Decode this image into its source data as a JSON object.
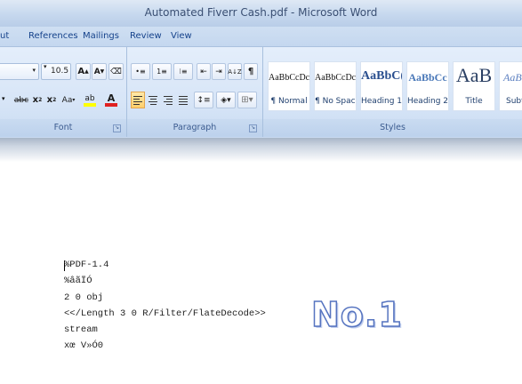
{
  "window": {
    "title": "Automated Fiverr Cash.pdf - Microsoft Word"
  },
  "tabs": [
    "ut",
    "References",
    "Mailings",
    "Review",
    "View"
  ],
  "font_group": {
    "label": "Font",
    "font_size": "10.5",
    "grow_glyph": "A",
    "shrink_glyph": "A",
    "clear_glyph": "⌫",
    "strike_glyph": "abc",
    "subscript_glyph": "x",
    "superscript_glyph": "x",
    "change_case_glyph": "Aa",
    "highlight_glyph": "ab",
    "font_color_glyph": "A",
    "highlight_color": "#ffff00",
    "font_color": "#e02020"
  },
  "paragraph_group": {
    "label": "Paragraph",
    "pilcrow": "¶",
    "sort_glyph": "A↓Z"
  },
  "styles_group": {
    "label": "Styles",
    "tiles": [
      {
        "sample": "AaBbCcDc",
        "name": "¶ Normal"
      },
      {
        "sample": "AaBbCcDc",
        "name": "¶ No Spaci..."
      },
      {
        "sample": "AaBbC(",
        "name": "Heading 1"
      },
      {
        "sample": "AaBbCc",
        "name": "Heading 2"
      },
      {
        "sample": "AaB",
        "name": "Title"
      },
      {
        "sample": "AaBb",
        "name": "Subti"
      }
    ]
  },
  "document": {
    "lines": [
      "%PDF-1.4",
      "%âãÏÓ",
      "2 0 obj",
      "<</Length 3 0 R/Filter/FlateDecode>>",
      "stream",
      "xœ V»Ó0"
    ],
    "overlay_text": "No.1"
  },
  "colors": {
    "ribbon": "#d7e5f7",
    "tab_text": "#15428b",
    "active_align": "#ffcf6b",
    "overlay_outline": "#5674c0"
  }
}
